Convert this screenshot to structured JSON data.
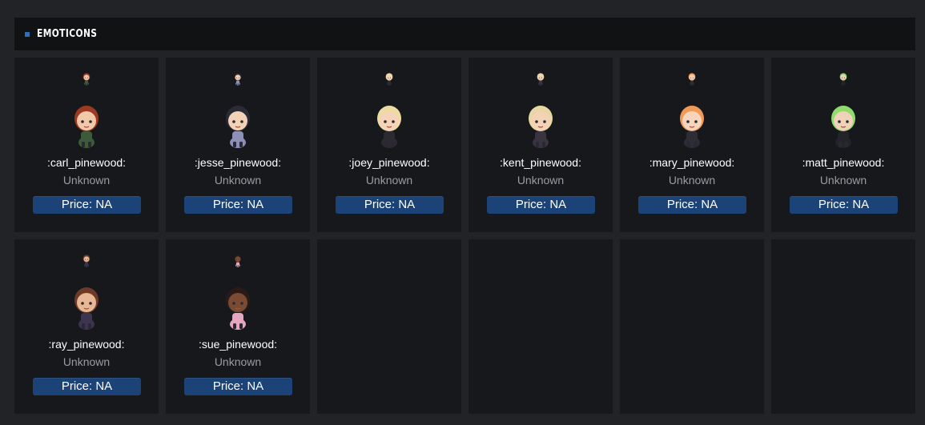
{
  "section": {
    "title": "EMOTICONS"
  },
  "emoticons": [
    {
      "name": ":carl_pinewood:",
      "status": "Unknown",
      "price": "Price: NA",
      "hair": "#9b3a22",
      "skin": "#f1c9a8",
      "outfit": "#3d5a3a"
    },
    {
      "name": ":jesse_pinewood:",
      "status": "Unknown",
      "price": "Price: NA",
      "hair": "#2a2b35",
      "skin": "#f3d2b6",
      "outfit": "#8d8fb8"
    },
    {
      "name": ":joey_pinewood:",
      "status": "Unknown",
      "price": "Price: NA",
      "hair": "#ecdca0",
      "skin": "#f4d3b8",
      "outfit": "#2a2a30"
    },
    {
      "name": ":kent_pinewood:",
      "status": "Unknown",
      "price": "Price: NA",
      "hair": "#e8d7a4",
      "skin": "#f3d2b6",
      "outfit": "#3a3340"
    },
    {
      "name": ":mary_pinewood:",
      "status": "Unknown",
      "price": "Price: NA",
      "hair": "#f09a58",
      "skin": "#f6d5bc",
      "outfit": "#2e2c35"
    },
    {
      "name": ":matt_pinewood:",
      "status": "Unknown",
      "price": "Price: NA",
      "hair": "#8fdc6c",
      "skin": "#f0d2b8",
      "outfit": "#24232a"
    },
    {
      "name": ":ray_pinewood:",
      "status": "Unknown",
      "price": "Price: NA",
      "hair": "#6e3a27",
      "skin": "#e8b894",
      "outfit": "#3d3450"
    },
    {
      "name": ":sue_pinewood:",
      "status": "Unknown",
      "price": "Price: NA",
      "hair": "#2a1a17",
      "skin": "#7a4b32",
      "outfit": "#e7a6c0"
    }
  ],
  "empty_slots": 4
}
